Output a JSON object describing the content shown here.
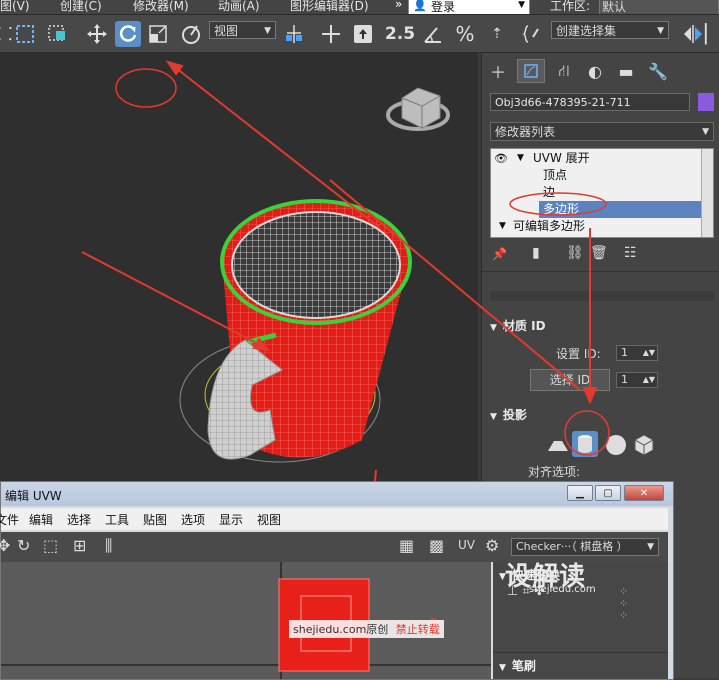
{
  "menubar": {
    "items": [
      "图(V)",
      "创建(C)",
      "修改器(M)",
      "动画(A)",
      "图形编辑器(D)"
    ],
    "overflow": "»",
    "login": "登录",
    "workspace_label": "工作区:",
    "workspace_value": "默认"
  },
  "toolbar": {
    "view_dropdown": "视图",
    "selection_set": "创建选择集",
    "snap_25": "2.5"
  },
  "command_panel": {
    "object_name": "Obj3d66-478395-21-711",
    "object_color": "#8a5be0",
    "modifier_list": "修改器列表",
    "stack": [
      {
        "label": "UVW 展开",
        "level": 0,
        "expanded": true,
        "eye": true
      },
      {
        "label": "顶点",
        "level": 1
      },
      {
        "label": "边",
        "level": 1
      },
      {
        "label": "多边形",
        "level": 1,
        "selected": true
      },
      {
        "label": "可编辑多边形",
        "level": 0,
        "expanded": true
      }
    ],
    "material_id": {
      "title": "材质 ID",
      "set_label": "设置 ID:",
      "set_value": "1",
      "select_button": "选择 ID",
      "select_value": "1"
    },
    "projection": {
      "title": "投影",
      "align_label": "对齐选项:"
    }
  },
  "uvw_editor": {
    "title": "编辑 UVW",
    "menu": [
      "文件",
      "编辑",
      "选择",
      "工具",
      "贴图",
      "选项",
      "显示",
      "视图"
    ],
    "uv_label": "UV",
    "checker_dropdown": "Checker···（ 棋盘格 ）",
    "quick_transform": "快速变换",
    "brush": "笔刷"
  },
  "watermark": {
    "site": "shejiedu.com",
    "original": "原创",
    "forbid": "禁止转载",
    "logo_text": "设解读",
    "logo_url": "shejiedu.com"
  },
  "colors": {
    "accent_blue": "#5b8fc8",
    "mug_red": "#e8201a",
    "annotation_red": "#e23a2f",
    "selection_green": "#3ad13a"
  }
}
